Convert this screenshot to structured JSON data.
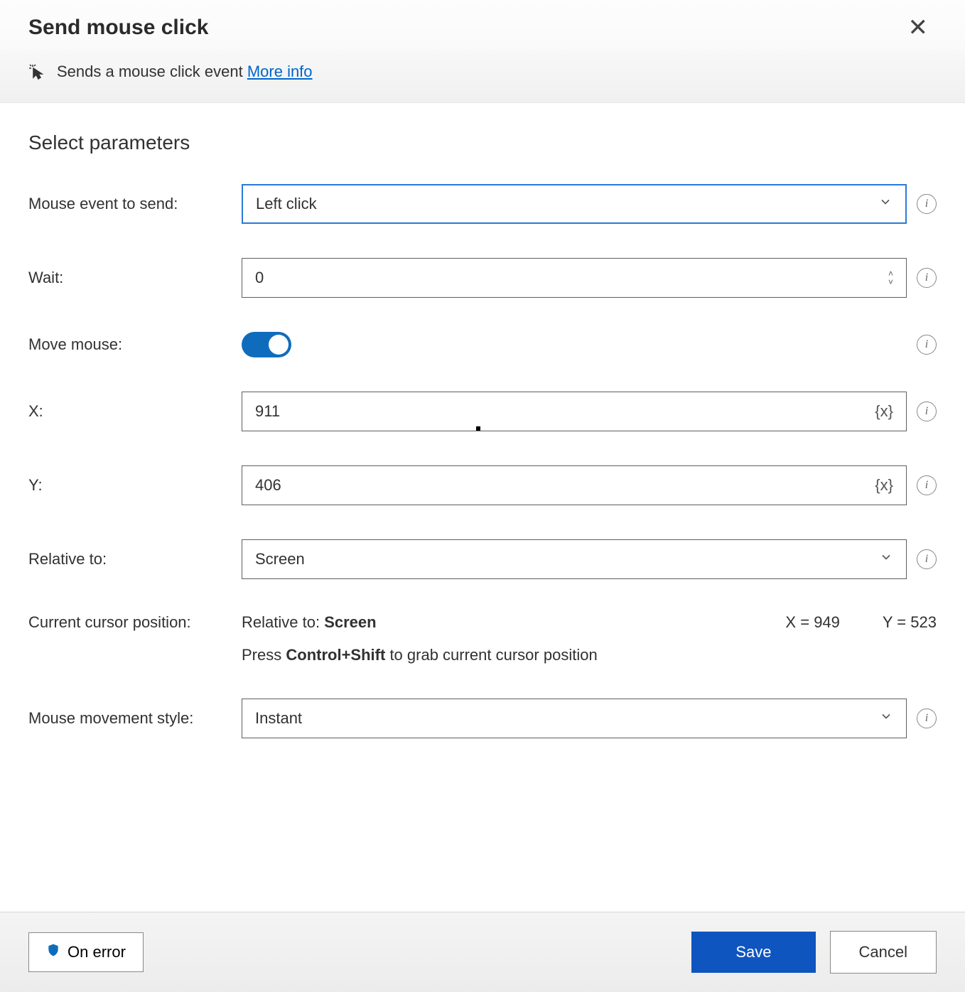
{
  "dialog": {
    "title": "Send mouse click",
    "description": "Sends a mouse click event",
    "more_info_label": "More info"
  },
  "section_title": "Select parameters",
  "params": {
    "mouse_event": {
      "label": "Mouse event to send:",
      "value": "Left click"
    },
    "wait": {
      "label": "Wait:",
      "value": "0"
    },
    "move_mouse": {
      "label": "Move mouse:",
      "value": true
    },
    "x": {
      "label": "X:",
      "value": "911"
    },
    "y": {
      "label": "Y:",
      "value": "406"
    },
    "relative_to": {
      "label": "Relative to:",
      "value": "Screen"
    },
    "movement": {
      "label": "Mouse movement style:",
      "value": "Instant"
    }
  },
  "cursor_position": {
    "label": "Current cursor position:",
    "relative_prefix": "Relative to:",
    "relative_value": "Screen",
    "x_label": "X =",
    "x_value": "949",
    "y_label": "Y =",
    "y_value": "523",
    "hint_prefix": "Press",
    "hint_keys": "Control+Shift",
    "hint_suffix": "to grab current cursor position"
  },
  "variable_token": "{x}",
  "footer": {
    "on_error": "On error",
    "save": "Save",
    "cancel": "Cancel"
  }
}
